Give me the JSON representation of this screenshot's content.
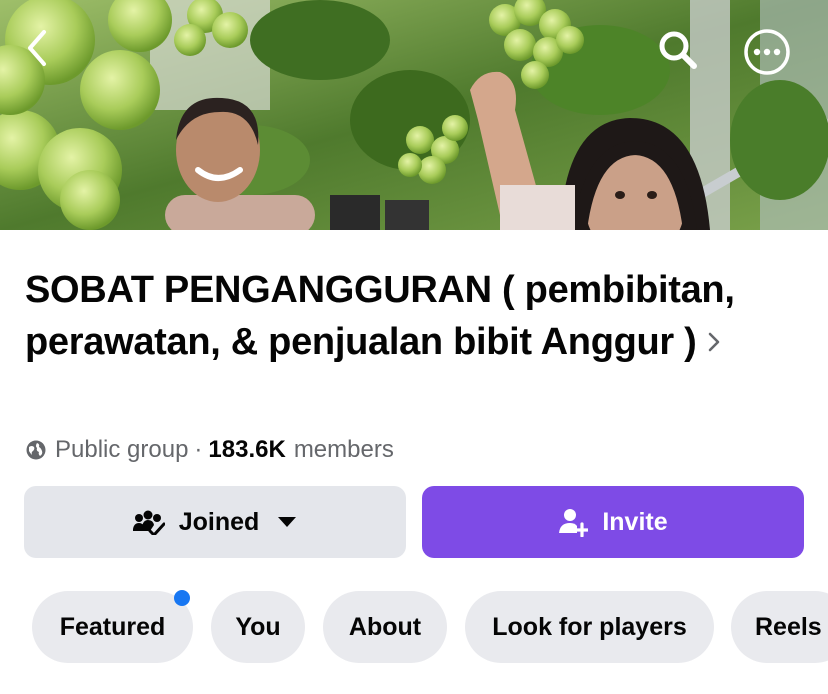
{
  "colors": {
    "accent": "#7e4be6",
    "secondary_button": "#e4e6eb",
    "notification_dot": "#1877f2",
    "muted_text": "#65676b"
  },
  "cover": {
    "back_icon": "chevron-left-icon",
    "search_icon": "search-icon",
    "more_icon": "more-horizontal-circle-icon"
  },
  "group": {
    "name": "SOBAT PENGANGGURAN ( pembibitan, perawatan, & penjualan bibit Anggur )",
    "privacy": "Public group",
    "separator": "·",
    "member_count": "183.6K",
    "members_label": "members",
    "privacy_icon": "globe-icon"
  },
  "actions": {
    "joined_label": "Joined",
    "joined_icon": "group-check-icon",
    "invite_label": "Invite",
    "invite_icon": "add-person-icon"
  },
  "tabs": [
    {
      "label": "Featured",
      "has_notification": true
    },
    {
      "label": "You"
    },
    {
      "label": "About"
    },
    {
      "label": "Look for players"
    },
    {
      "label": "Reels"
    }
  ]
}
